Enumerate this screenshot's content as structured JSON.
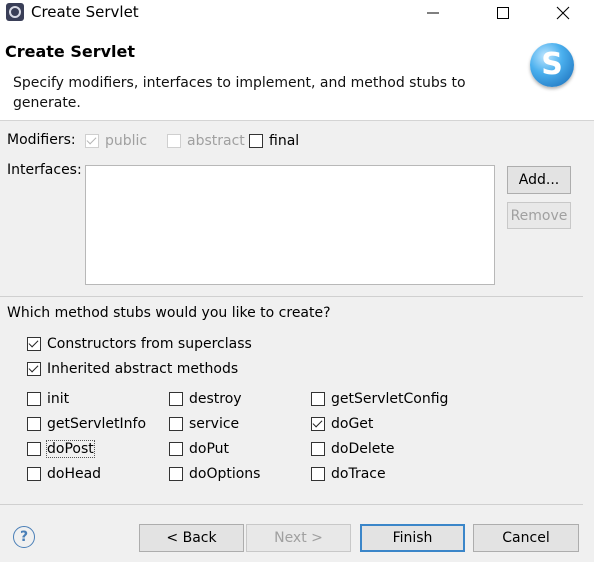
{
  "window": {
    "title": "Create Servlet"
  },
  "header": {
    "title": "Create Servlet",
    "description": "Specify modifiers, interfaces to implement, and method stubs to generate."
  },
  "modifiers": {
    "label": "Modifiers:",
    "public": {
      "label": "public",
      "checked": true,
      "enabled": false
    },
    "abstract": {
      "label": "abstract",
      "checked": false,
      "enabled": false
    },
    "final": {
      "label": "final",
      "checked": false,
      "enabled": true
    }
  },
  "interfaces": {
    "label": "Interfaces:",
    "items": [],
    "add_label": "Add...",
    "remove_label": "Remove"
  },
  "stubs": {
    "question": "Which method stubs would you like to create?",
    "constructors": {
      "label": "Constructors from superclass",
      "checked": true
    },
    "inherited": {
      "label": "Inherited abstract methods",
      "checked": true
    },
    "methods": [
      {
        "label": "init",
        "checked": false
      },
      {
        "label": "destroy",
        "checked": false
      },
      {
        "label": "getServletConfig",
        "checked": false
      },
      {
        "label": "getServletInfo",
        "checked": false
      },
      {
        "label": "service",
        "checked": false
      },
      {
        "label": "doGet",
        "checked": true
      },
      {
        "label": "doPost",
        "checked": false
      },
      {
        "label": "doPut",
        "checked": false
      },
      {
        "label": "doDelete",
        "checked": false
      },
      {
        "label": "doHead",
        "checked": false
      },
      {
        "label": "doOptions",
        "checked": false
      },
      {
        "label": "doTrace",
        "checked": false
      }
    ]
  },
  "footer": {
    "back_label": "< Back",
    "next_label": "Next >",
    "finish_label": "Finish",
    "cancel_label": "Cancel"
  },
  "icons": {
    "app": "eclipse-gear-icon",
    "logo": "servlet-s-logo-icon",
    "help": "help-question-icon"
  },
  "colors": {
    "accent": "#3b86c9",
    "logo": "#1e8fdc"
  }
}
